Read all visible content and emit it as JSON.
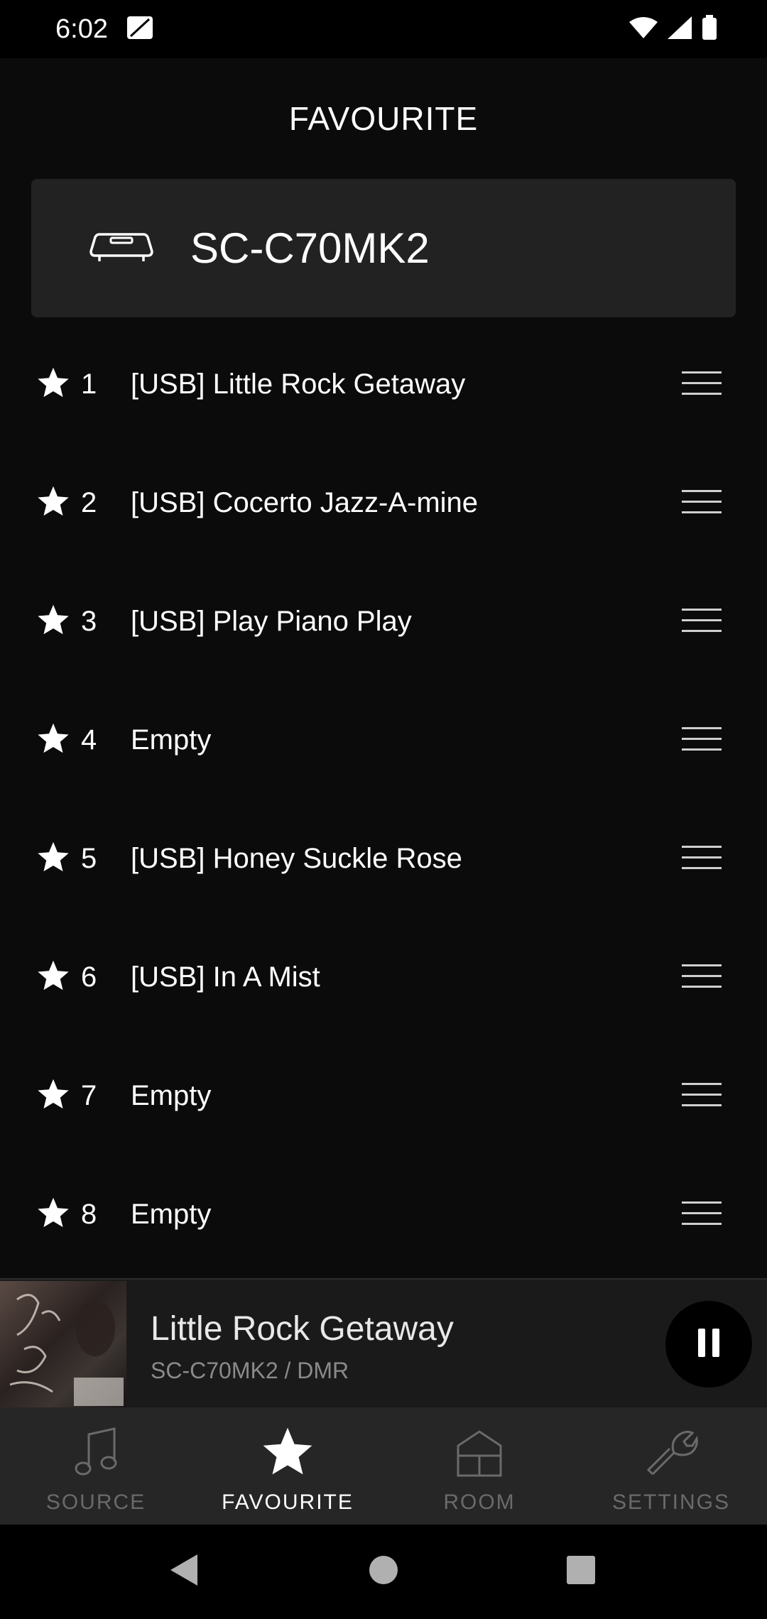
{
  "status": {
    "time": "6:02"
  },
  "header": {
    "title": "FAVOURITE"
  },
  "device": {
    "name": "SC-C70MK2"
  },
  "favourites": [
    {
      "num": "1",
      "title": "[USB] Little Rock Getaway"
    },
    {
      "num": "2",
      "title": "[USB] Cocerto Jazz-A-mine"
    },
    {
      "num": "3",
      "title": "[USB] Play Piano Play"
    },
    {
      "num": "4",
      "title": "Empty"
    },
    {
      "num": "5",
      "title": "[USB] Honey Suckle Rose"
    },
    {
      "num": "6",
      "title": "[USB] In A Mist"
    },
    {
      "num": "7",
      "title": "Empty"
    },
    {
      "num": "8",
      "title": "Empty"
    }
  ],
  "now_playing": {
    "title": "Little Rock Getaway",
    "subtitle": "SC-C70MK2  / DMR"
  },
  "nav": {
    "items": [
      {
        "label": "SOURCE",
        "icon": "music-note-icon",
        "active": false
      },
      {
        "label": "FAVOURITE",
        "icon": "star-icon",
        "active": true
      },
      {
        "label": "ROOM",
        "icon": "room-icon",
        "active": false
      },
      {
        "label": "SETTINGS",
        "icon": "wrench-icon",
        "active": false
      }
    ]
  },
  "colors": {
    "background": "#0b0b0b",
    "card": "#222222",
    "nav_bg": "#262626",
    "inactive": "#6a6a6a",
    "active": "#ffffff"
  }
}
